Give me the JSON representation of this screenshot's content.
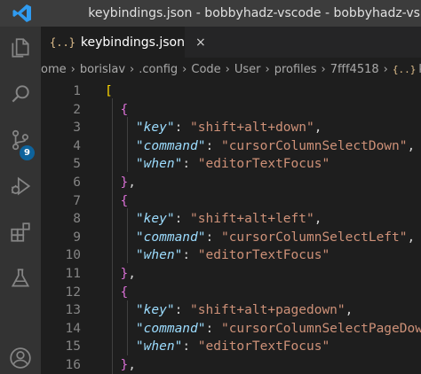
{
  "window": {
    "title": "keybindings.json - bobbyhadz-vscode - bobbyhadz-vs..."
  },
  "activity_bar": {
    "items": [
      {
        "icon": "files-icon"
      },
      {
        "icon": "search-icon"
      },
      {
        "icon": "source-control-icon",
        "badge": "9"
      },
      {
        "icon": "run-debug-icon"
      },
      {
        "icon": "extensions-icon"
      },
      {
        "icon": "testing-icon"
      },
      {
        "icon": "account-icon"
      }
    ]
  },
  "tab": {
    "icon": "{..}",
    "label": "keybindings.json",
    "close": "×"
  },
  "breadcrumb": {
    "items": [
      "ome",
      "borislav",
      ".config",
      "Code",
      "User",
      "profiles",
      "7fff4518"
    ],
    "file_icon": "{..}",
    "file": "keyb"
  },
  "editor": {
    "lines": [
      {
        "n": "1",
        "code": "["
      },
      {
        "n": "2",
        "code": "{"
      },
      {
        "n": "3",
        "key": "key",
        "value": "shift+alt+down",
        "comma": true
      },
      {
        "n": "4",
        "key": "command",
        "value": "cursorColumnSelectDown",
        "comma": true
      },
      {
        "n": "5",
        "key": "when",
        "value": "editorTextFocus",
        "comma": false
      },
      {
        "n": "6",
        "code": "},"
      },
      {
        "n": "7",
        "code": "{"
      },
      {
        "n": "8",
        "key": "key",
        "value": "shift+alt+left",
        "comma": true
      },
      {
        "n": "9",
        "key": "command",
        "value": "cursorColumnSelectLeft",
        "comma": true
      },
      {
        "n": "10",
        "key": "when",
        "value": "editorTextFocus",
        "comma": false
      },
      {
        "n": "11",
        "code": "},"
      },
      {
        "n": "12",
        "code": "{"
      },
      {
        "n": "13",
        "key": "key",
        "value": "shift+alt+pagedown",
        "comma": true
      },
      {
        "n": "14",
        "key": "command",
        "value": "cursorColumnSelectPageDown",
        "comma": true
      },
      {
        "n": "15",
        "key": "when",
        "value": "editorTextFocus",
        "comma": false
      },
      {
        "n": "16",
        "code": "},"
      }
    ]
  },
  "colors": {
    "bracket_level_1": "#ffd700",
    "bracket_level_2": "#da70d6",
    "json_key": "#9cdcfe",
    "json_string": "#ce9178",
    "badge": "#0e639c"
  }
}
